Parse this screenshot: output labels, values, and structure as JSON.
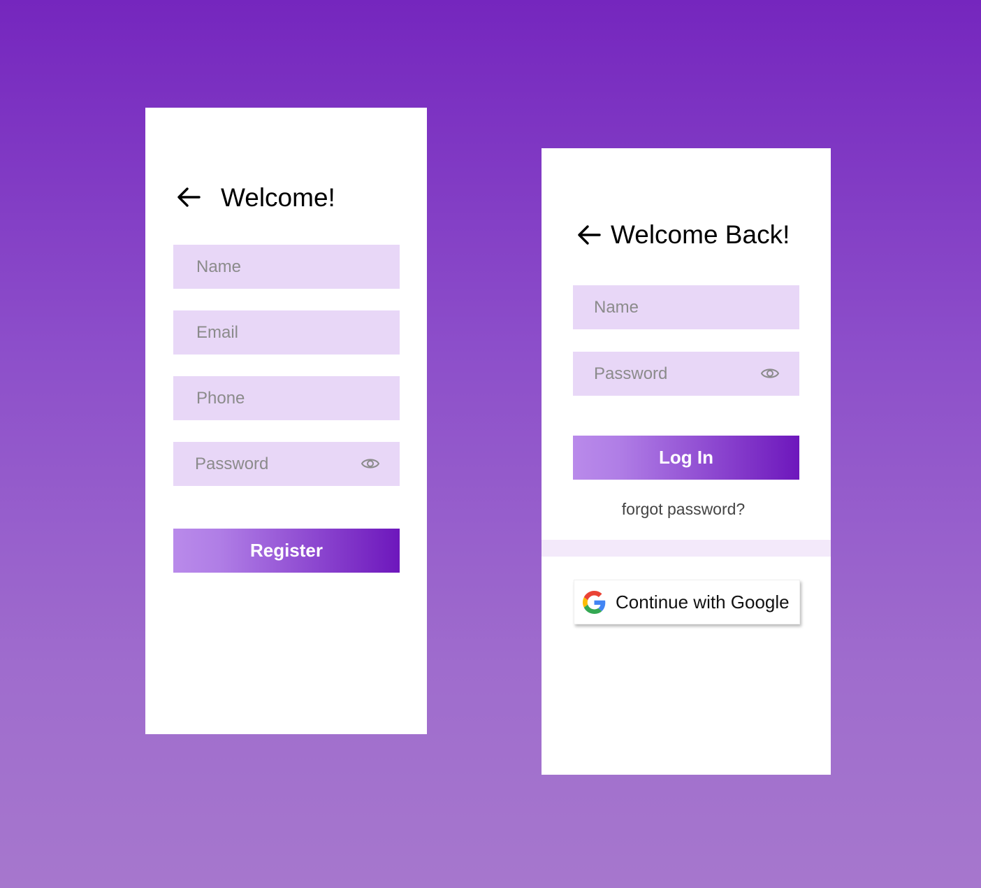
{
  "colors": {
    "background_top": "#7526be",
    "background_bottom": "#a677cd",
    "card": "#ffffff",
    "field_fill": "#e8d7f7",
    "placeholder_text": "#8b8b8b",
    "button_gradient_start": "#b98aea",
    "button_gradient_end": "#6d17bc",
    "divider": "#f3e9fa"
  },
  "register": {
    "back_icon": "arrow-left-icon",
    "title": "Welcome!",
    "fields": {
      "name_placeholder": "Name",
      "email_placeholder": "Email",
      "phone_placeholder": "Phone",
      "password_placeholder": "Password"
    },
    "password_toggle_icon": "eye-icon",
    "button_label": "Register"
  },
  "login": {
    "back_icon": "arrow-left-icon",
    "title": "Welcome Back!",
    "fields": {
      "name_placeholder": "Name",
      "password_placeholder": "Password"
    },
    "password_toggle_icon": "eye-icon",
    "button_label": "Log In",
    "forgot_password_label": "forgot password?",
    "google_icon": "google-icon",
    "google_button_label": "Continue with Google"
  }
}
